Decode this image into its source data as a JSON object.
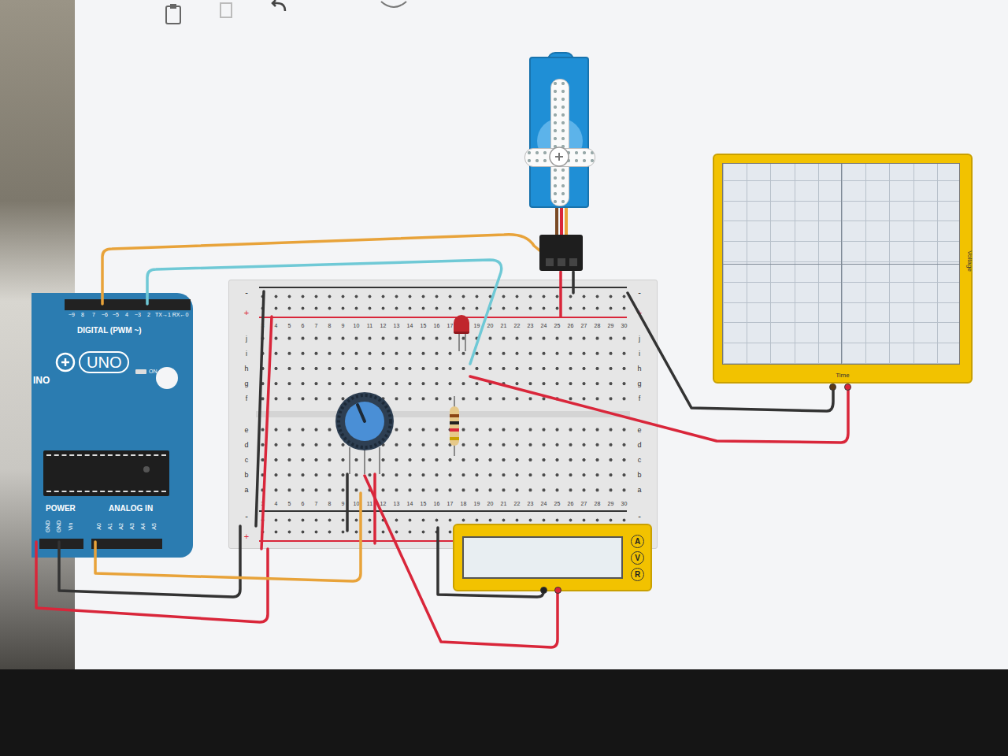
{
  "arduino": {
    "digital_label": "DIGITAL (PWM ~)",
    "digital_pins": [
      "~9",
      "8",
      "7",
      "~6",
      "~5",
      "4",
      "~3",
      "2",
      "TX→1",
      "RX←0"
    ],
    "model": "UNO",
    "brand": "INO",
    "on_label": "ON",
    "power_label": "POWER",
    "power_pins": [
      "GND",
      "GND",
      "Vin"
    ],
    "analog_label": "ANALOG IN",
    "analog_pins": [
      "A0",
      "A1",
      "A2",
      "A3",
      "A4",
      "A5"
    ]
  },
  "breadboard": {
    "columns": [
      "3",
      "4",
      "5",
      "6",
      "7",
      "8",
      "9",
      "10",
      "11",
      "12",
      "13",
      "14",
      "15",
      "16",
      "17",
      "18",
      "19",
      "20",
      "21",
      "22",
      "23",
      "24",
      "25",
      "26",
      "27",
      "28",
      "29",
      "30"
    ],
    "rows_top": [
      "j",
      "i",
      "h",
      "g",
      "f"
    ],
    "rows_bottom": [
      "e",
      "d",
      "c",
      "b",
      "a"
    ],
    "rail_minus": "-",
    "rail_plus": "+"
  },
  "oscilloscope": {
    "x_label": "Time",
    "y_label": "Voltage"
  },
  "multimeter": {
    "modes": [
      "A",
      "V",
      "R"
    ]
  },
  "wires": [
    {
      "color": "#e8a33a"
    },
    {
      "color": "#6fc9d6"
    },
    {
      "color": "#d9263a"
    },
    {
      "color": "#333333"
    },
    {
      "color": "#333333"
    },
    {
      "color": "#d9263a"
    },
    {
      "color": "#d9263a"
    },
    {
      "color": "#333333"
    },
    {
      "color": "#e8a33a"
    },
    {
      "color": "#d9263a"
    },
    {
      "color": "#333333"
    },
    {
      "color": "#333333"
    },
    {
      "color": "#d9263a"
    },
    {
      "color": "#d9263a"
    },
    {
      "color": "#333333"
    }
  ]
}
